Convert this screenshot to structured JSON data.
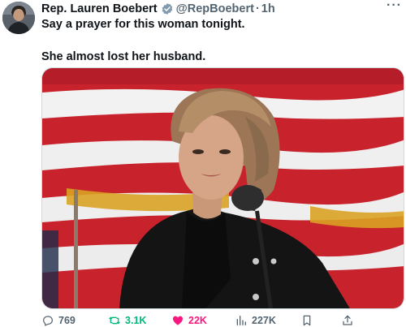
{
  "tweet": {
    "author_name": "Rep. Lauren Boebert",
    "author_handle": "@RepBoebert",
    "separator": "·",
    "time": "1h",
    "more_label": "···",
    "verified_icon": "verified-badge-icon",
    "lines": [
      "Say a prayer for this woman tonight.",
      "She almost lost her husband."
    ]
  },
  "actions": {
    "replies": "769",
    "retweets": "3.1K",
    "likes": "22K",
    "views": "227K"
  },
  "colors": {
    "retweet": "#00ba7c",
    "like": "#f91880",
    "muted": "#536471",
    "text": "#0f1419"
  }
}
